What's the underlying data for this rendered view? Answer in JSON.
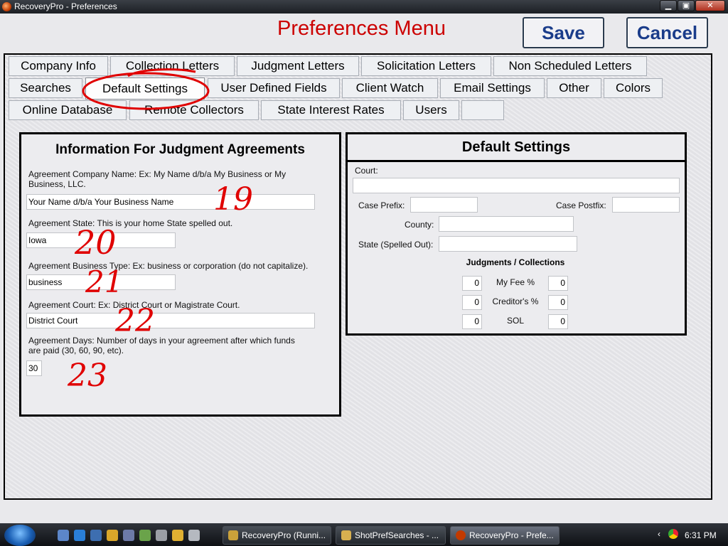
{
  "window": {
    "title": "RecoveryPro - Preferences"
  },
  "header": {
    "title": "Preferences Menu",
    "save_label": "Save",
    "cancel_label": "Cancel"
  },
  "tabs": {
    "row1": [
      "Company Info",
      "Collection Letters",
      "Judgment Letters",
      "Solicitation Letters",
      "Non Scheduled Letters"
    ],
    "row2": [
      "Searches",
      "Default Settings",
      "User Defined Fields",
      "Client Watch",
      "Email Settings",
      "Other",
      "Colors"
    ],
    "row3": [
      "Online Database",
      "Remote Collectors",
      "State Interest Rates",
      "Users",
      ""
    ],
    "active": "Default Settings"
  },
  "judgment_agreements": {
    "title": "Information For Judgment Agreements",
    "company_name_label": "Agreement Company Name:  Ex: My Name d/b/a My Business or My Business, LLC.",
    "company_name_value": "Your Name d/b/a Your Business Name",
    "state_label": "Agreement State: This is your home State spelled out.",
    "state_value": "Iowa",
    "business_type_label": "Agreement Business Type: Ex: business or corporation (do not capitalize).",
    "business_type_value": "business",
    "court_label": "Agreement Court: Ex: District Court or Magistrate Court.",
    "court_value": "District Court",
    "days_label": "Agreement Days: Number of days in your agreement after which funds are paid (30, 60, 90, etc).",
    "days_value": "30"
  },
  "default_settings": {
    "title": "Default Settings",
    "court_label": "Court:",
    "court_value": "",
    "case_prefix_label": "Case Prefix:",
    "case_prefix_value": "",
    "case_postfix_label": "Case Postfix:",
    "case_postfix_value": "",
    "county_label": "County:",
    "county_value": "",
    "state_label": "State (Spelled Out):",
    "state_value": "",
    "judgments_title": "Judgments / Collections",
    "my_fee_label": "My Fee %",
    "my_fee_left": "0",
    "my_fee_right": "0",
    "creditor_label": "Creditor's %",
    "creditor_left": "0",
    "creditor_right": "0",
    "sol_label": "SOL",
    "sol_left": "0",
    "sol_right": "0"
  },
  "annotations": [
    "19",
    "20",
    "21",
    "22",
    "23"
  ],
  "colors": {
    "title_red": "#cc0000",
    "button_text": "#1a3c8a",
    "annotation_red": "#e00000"
  },
  "taskbar": {
    "tasks": [
      "RecoveryPro (Runni...",
      "ShotPrefSearches - ...",
      "RecoveryPro - Prefe..."
    ],
    "clock": "6:31 PM"
  }
}
